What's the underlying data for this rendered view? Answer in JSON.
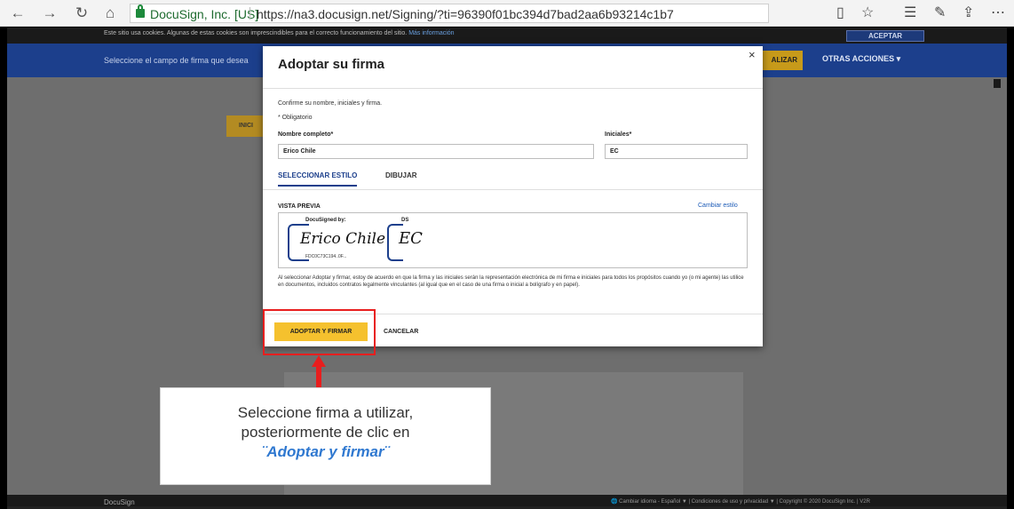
{
  "browser": {
    "site_name": "DocuSign, Inc. [US]",
    "url": "https://na3.docusign.net/Signing/?ti=96390f01bc394d7bad2aa6b93214c1b7",
    "icons": [
      "back-icon",
      "forward-icon",
      "refresh-icon",
      "home-icon",
      "lock-icon",
      "reading-view-icon",
      "favorite-icon",
      "favorites-list-icon",
      "pen-icon",
      "share-icon",
      "more-icon"
    ]
  },
  "cookie_bar": {
    "text": "Este sitio usa cookies. Algunas de estas cookies son imprescindibles para el correcto funcionamiento del sitio.",
    "link": "Más información",
    "accept": "ACEPTAR"
  },
  "signing_bar": {
    "message": "Seleccione el campo de firma que desea",
    "finalize": "ALIZAR",
    "other_actions": "OTRAS ACCIONES ▾"
  },
  "document": {
    "start_label": "INICI"
  },
  "modal": {
    "title": "Adoptar su firma",
    "close": "×",
    "confirm_text": "Confirme su nombre, iniciales y firma.",
    "required_note": "* Obligatorio",
    "full_name_label": "Nombre completo*",
    "full_name_value": "Erico Chile",
    "initials_label": "Iniciales*",
    "initials_value": "EC",
    "tabs": [
      {
        "label": "SELECCIONAR ESTILO",
        "active": true
      },
      {
        "label": "DIBUJAR",
        "active": false
      }
    ],
    "preview_label": "VISTA PREVIA",
    "change_style": "Cambiar estilo",
    "signature": {
      "header": "DocuSigned by:",
      "script": "Erico Chile",
      "id": "FDC0C73C194..0F..."
    },
    "initials_sig": {
      "header": "DS",
      "script": "EC"
    },
    "legal_text": "Al seleccionar Adoptar y firmar, estoy de acuerdo en que la firma y las iniciales serán la representación electrónica de mi firma e iniciales para todos los propósitos cuando yo (o mi agente) las utilice en documentos, incluidos contratos legalmente vinculantes (al igual que en el caso de una firma o inicial a bolígrafo y en papel).",
    "adopt_button": "ADOPTAR Y FIRMAR",
    "cancel_button": "CANCELAR"
  },
  "footer": {
    "brand": "DocuSign",
    "right": "🌐 Cambiar idioma - Español  ▼   |   Condiciones de uso y privacidad  ▼   |   Copyright © 2020 DocuSign Inc. | V2R"
  },
  "annotation": {
    "line1": "Seleccione firma a utilizar,",
    "line2": "posteriormente de clic en",
    "line3": "¨Adoptar y firmar¨",
    "highlight_color": "#e81e1e",
    "accent_color": "#2f78d0"
  }
}
